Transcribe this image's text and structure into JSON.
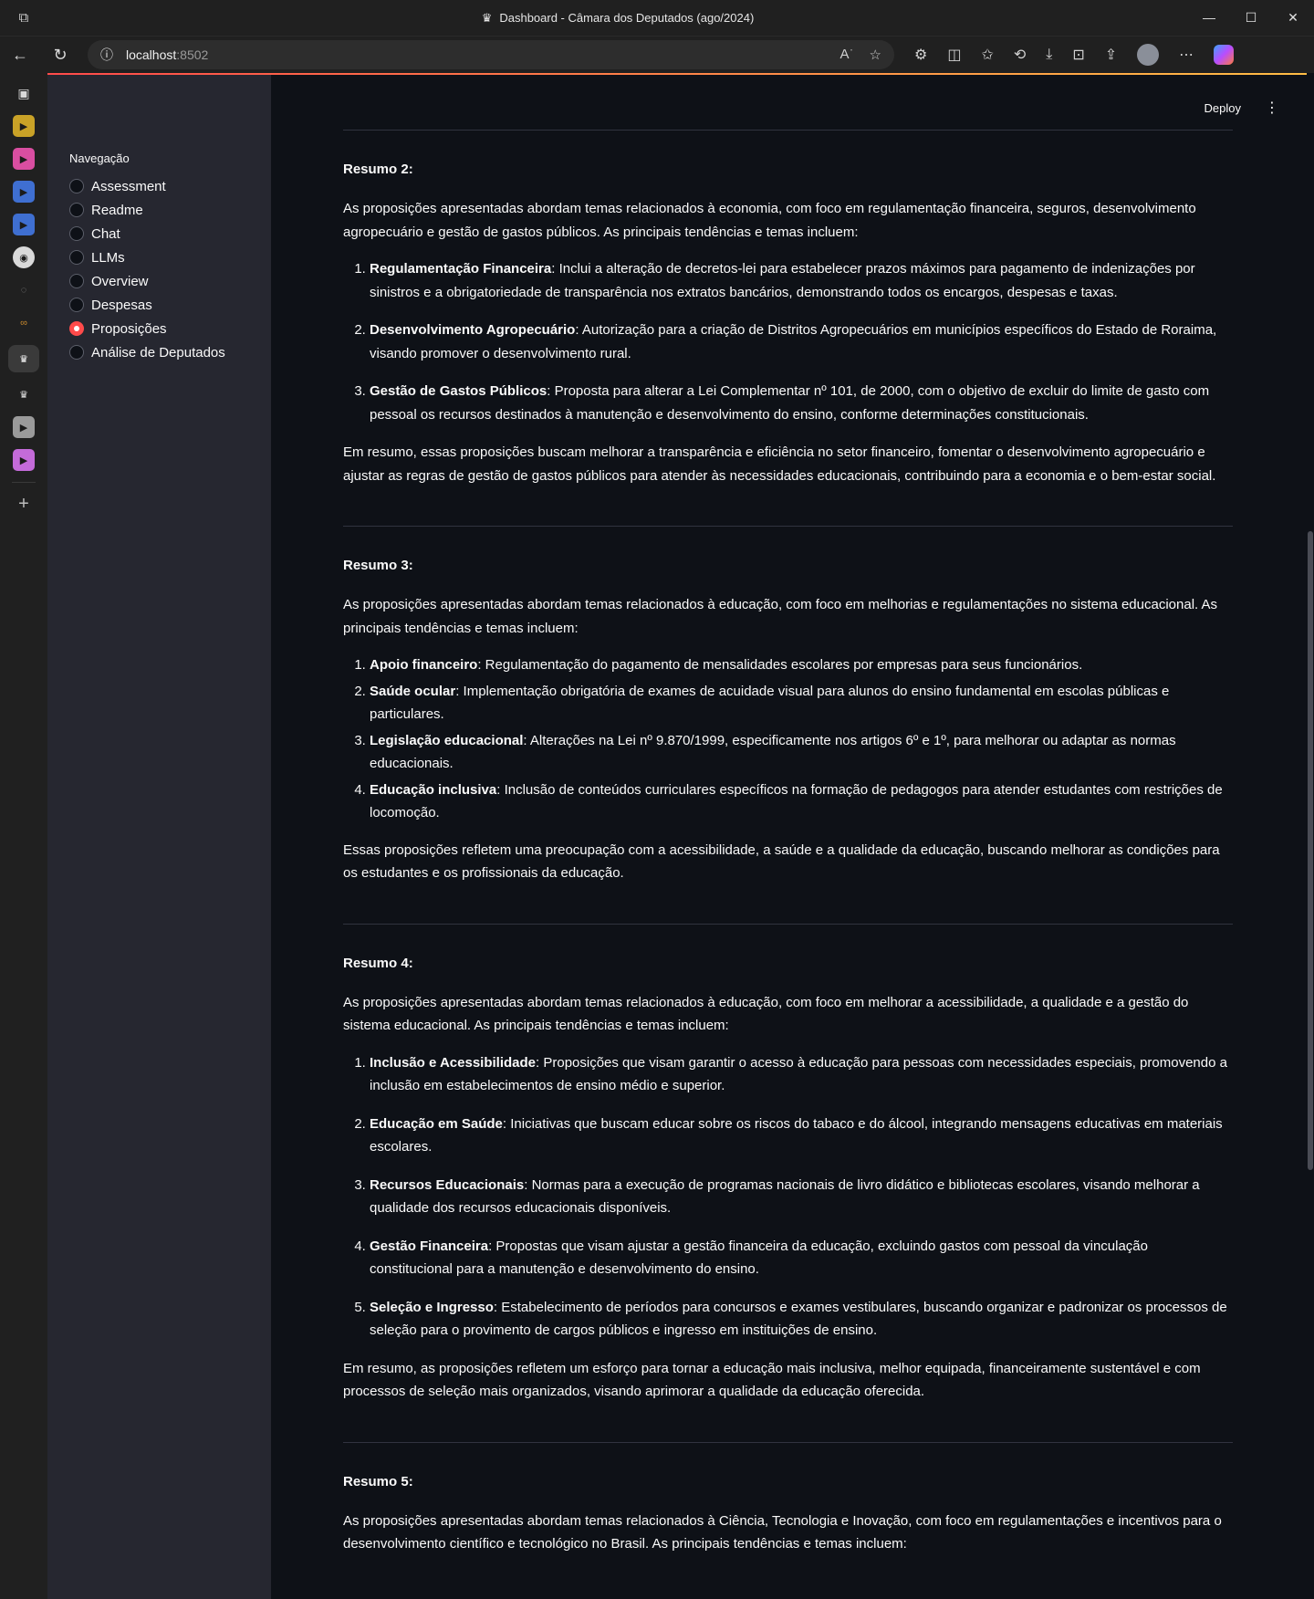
{
  "window": {
    "title": "Dashboard - Câmara dos Deputados (ago/2024)",
    "controls": [
      "—",
      "☐",
      "✕"
    ]
  },
  "browser": {
    "url_host": "localhost",
    "url_port": ":8502"
  },
  "streamlit": {
    "deploy_label": "Deploy",
    "menu_icon": "⋮"
  },
  "sidebar": {
    "nav_label": "Navegação",
    "items": [
      {
        "label": "Assessment",
        "selected": false
      },
      {
        "label": "Readme",
        "selected": false
      },
      {
        "label": "Chat",
        "selected": false
      },
      {
        "label": "LLMs",
        "selected": false
      },
      {
        "label": "Overview",
        "selected": false
      },
      {
        "label": "Despesas",
        "selected": false
      },
      {
        "label": "Proposições",
        "selected": true
      },
      {
        "label": "Análise de Deputados",
        "selected": false
      }
    ]
  },
  "summaries": [
    {
      "title": "Resumo 2:",
      "intro": "As proposições apresentadas abordam temas relacionados à economia, com foco em regulamentação financeira, seguros, desenvolvimento agropecuário e gestão de gastos públicos. As principais tendências e temas incluem:",
      "items": [
        {
          "term": "Regulamentação Financeira",
          "text": ": Inclui a alteração de decretos-lei para estabelecer prazos máximos para pagamento de indenizações por sinistros e a obrigatoriedade de transparência nos extratos bancários, demonstrando todos os encargos, despesas e taxas."
        },
        {
          "term": "Desenvolvimento Agropecuário",
          "text": ": Autorização para a criação de Distritos Agropecuários em municípios específicos do Estado de Roraima, visando promover o desenvolvimento rural."
        },
        {
          "term": "Gestão de Gastos Públicos",
          "text": ": Proposta para alterar a Lei Complementar nº 101, de 2000, com o objetivo de excluir do limite de gasto com pessoal os recursos destinados à manutenção e desenvolvimento do ensino, conforme determinações constitucionais."
        }
      ],
      "conclusion": "Em resumo, essas proposições buscam melhorar a transparência e eficiência no setor financeiro, fomentar o desenvolvimento agropecuário e ajustar as regras de gestão de gastos públicos para atender às necessidades educacionais, contribuindo para a economia e o bem-estar social."
    },
    {
      "title": "Resumo 3:",
      "intro": "As proposições apresentadas abordam temas relacionados à educação, com foco em melhorias e regulamentações no sistema educacional. As principais tendências e temas incluem:",
      "items": [
        {
          "term": "Apoio financeiro",
          "text": ": Regulamentação do pagamento de mensalidades escolares por empresas para seus funcionários."
        },
        {
          "term": "Saúde ocular",
          "text": ": Implementação obrigatória de exames de acuidade visual para alunos do ensino fundamental em escolas públicas e particulares."
        },
        {
          "term": "Legislação educacional",
          "text": ": Alterações na Lei nº 9.870/1999, especificamente nos artigos 6º e 1º, para melhorar ou adaptar as normas educacionais."
        },
        {
          "term": "Educação inclusiva",
          "text": ": Inclusão de conteúdos curriculares específicos na formação de pedagogos para atender estudantes com restrições de locomoção."
        }
      ],
      "conclusion": "Essas proposições refletem uma preocupação com a acessibilidade, a saúde e a qualidade da educação, buscando melhorar as condições para os estudantes e os profissionais da educação."
    },
    {
      "title": "Resumo 4:",
      "intro": "As proposições apresentadas abordam temas relacionados à educação, com foco em melhorar a acessibilidade, a qualidade e a gestão do sistema educacional. As principais tendências e temas incluem:",
      "items": [
        {
          "term": "Inclusão e Acessibilidade",
          "text": ": Proposições que visam garantir o acesso à educação para pessoas com necessidades especiais, promovendo a inclusão em estabelecimentos de ensino médio e superior."
        },
        {
          "term": "Educação em Saúde",
          "text": ": Iniciativas que buscam educar sobre os riscos do tabaco e do álcool, integrando mensagens educativas em materiais escolares."
        },
        {
          "term": "Recursos Educacionais",
          "text": ": Normas para a execução de programas nacionais de livro didático e bibliotecas escolares, visando melhorar a qualidade dos recursos educacionais disponíveis."
        },
        {
          "term": "Gestão Financeira",
          "text": ": Propostas que visam ajustar a gestão financeira da educação, excluindo gastos com pessoal da vinculação constitucional para a manutenção e desenvolvimento do ensino."
        },
        {
          "term": "Seleção e Ingresso",
          "text": ": Estabelecimento de períodos para concursos e exames vestibulares, buscando organizar e padronizar os processos de seleção para o provimento de cargos públicos e ingresso em instituições de ensino."
        }
      ],
      "conclusion": "Em resumo, as proposições refletem um esforço para tornar a educação mais inclusiva, melhor equipada, financeiramente sustentável e com processos de seleção mais organizados, visando aprimorar a qualidade da educação oferecida."
    },
    {
      "title": "Resumo 5:",
      "intro": "As proposições apresentadas abordam temas relacionados à Ciência, Tecnologia e Inovação, com foco em regulamentações e incentivos para o desenvolvimento científico e tecnológico no Brasil. As principais tendências e temas incluem:",
      "items": [],
      "conclusion": ""
    }
  ],
  "colors": {
    "background": "#0e1117",
    "sidebar": "#262730",
    "accent": "#ff4b4b"
  }
}
